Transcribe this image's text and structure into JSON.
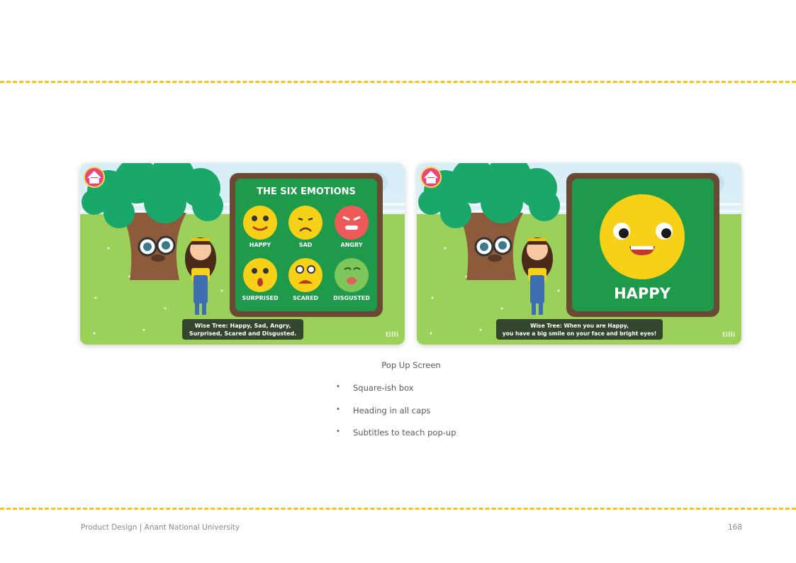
{
  "screens": [
    {
      "panel_title": "THE SIX EMOTIONS",
      "emotions": [
        {
          "label": "HAPPY",
          "color": "#f7d117"
        },
        {
          "label": "SAD",
          "color": "#f7d117"
        },
        {
          "label": "ANGRY",
          "color": "#ee5a5a"
        },
        {
          "label": "SURPRISED",
          "color": "#f7d117"
        },
        {
          "label": "SCARED",
          "color": "#f7d117"
        },
        {
          "label": "DISGUSTED",
          "color": "#7cc65a"
        }
      ],
      "subtitle_line1": "Wise Tree: Happy, Sad, Angry,",
      "subtitle_line2": "Surprised, Scared and Disgusted.",
      "watermark": "tilli"
    },
    {
      "panel_title": "HAPPY",
      "subtitle_line1": "Wise Tree: When you are Happy,",
      "subtitle_line2": "you have a big smile on your face and bright eyes!",
      "watermark": "tilli"
    }
  ],
  "caption": {
    "title": "Pop Up Screen",
    "bullets": [
      "Square-ish box",
      "Heading in all caps",
      "Subtitles to teach pop-up"
    ]
  },
  "footer": {
    "left": "Product Design | Anant National University",
    "page_number": "168"
  },
  "colors": {
    "dash": "#f5c518",
    "grass": "#9bd05a",
    "board_frame": "#6b4a35",
    "board_fill": "#1e9a4a",
    "tree_canopy": "#1aa86a",
    "home_button": "#e8457f"
  },
  "icons": [
    "home-icon"
  ]
}
